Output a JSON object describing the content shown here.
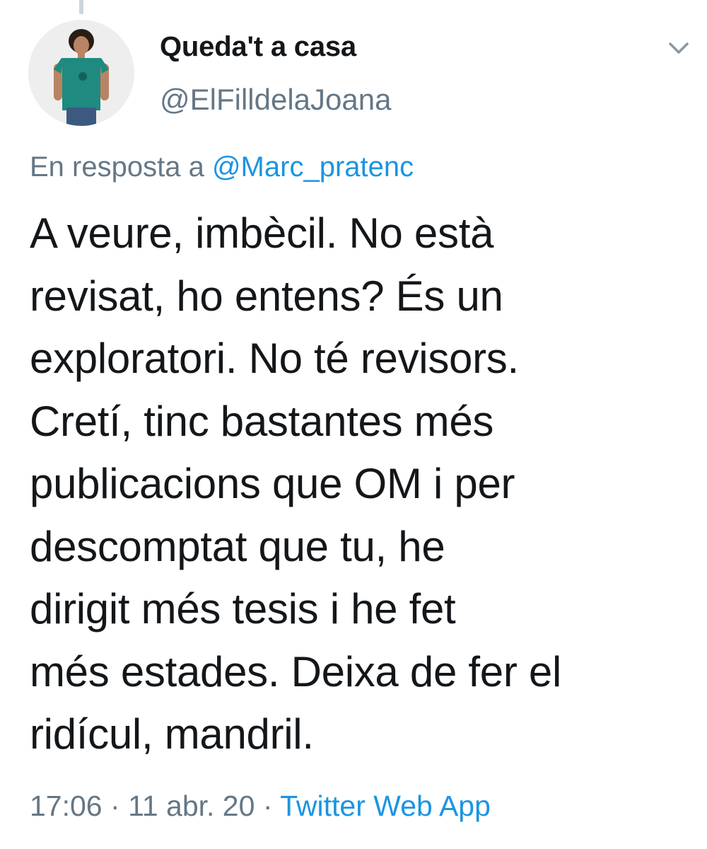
{
  "author": {
    "display_name": "Queda't a casa",
    "handle": "@ElFilldelaJoana",
    "avatar_icon": "user-avatar"
  },
  "reply": {
    "prefix": "En resposta a",
    "mention": "@Marc_pratenc"
  },
  "tweet": {
    "lines": [
      "A veure, imbècil. No està",
      "revisat, ho entens? És un",
      "exploratori. No té revisors.",
      "Cretí, tinc bastantes més",
      "publicacions que OM i per",
      "descomptat que tu, he",
      "dirigit més tesis i he fet",
      "més estades. Deixa de fer el",
      "ridícul, mandril."
    ]
  },
  "meta": {
    "time": "17:06",
    "separator": "·",
    "date": "11 abr. 20",
    "source": "Twitter Web App"
  },
  "menu": {
    "icon": "chevron-down-icon"
  },
  "colors": {
    "link": "#1b95e0",
    "secondary_text": "#657786",
    "primary_text": "#14171a",
    "avatar_shirt": "#1f8a80"
  }
}
